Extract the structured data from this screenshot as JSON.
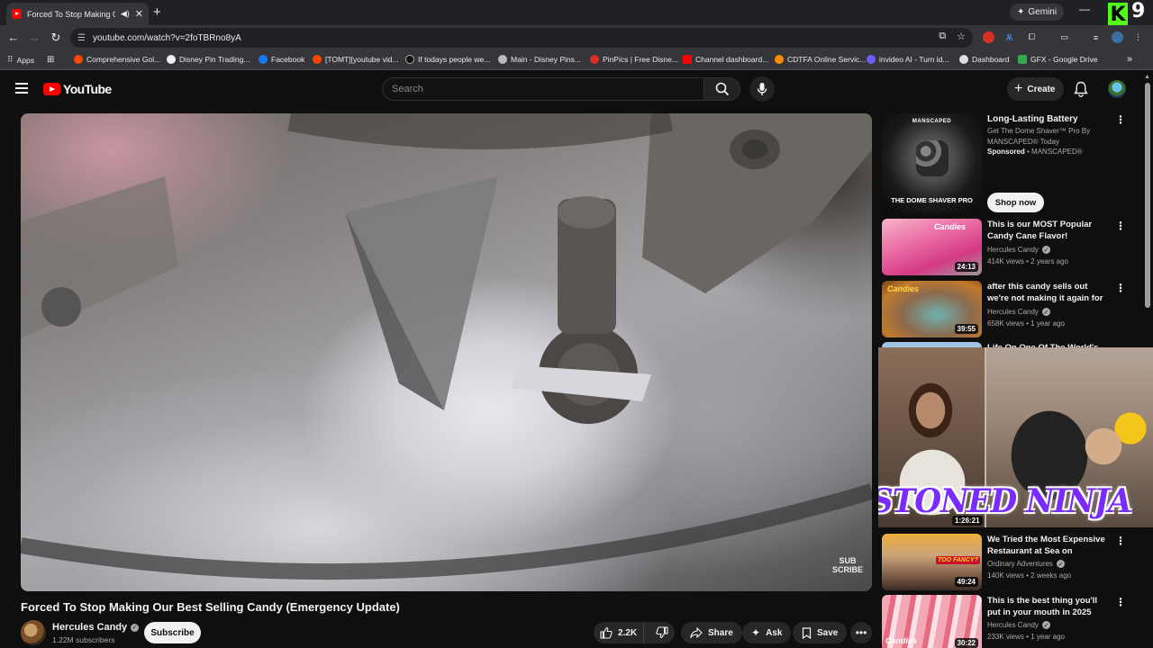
{
  "browser": {
    "tab_title": "Forced To Stop Making Ou",
    "gemini_label": "Gemini",
    "url": "youtube.com/watch?v=2foTBRno8yA",
    "kick_badge": "9",
    "bookmarks": [
      {
        "label": "Apps",
        "color": "#e8eaed"
      },
      {
        "label": "Comprehensive Gol...",
        "color": "#ff4500"
      },
      {
        "label": "Disney Pin Trading...",
        "color": "#f1f1f1"
      },
      {
        "label": "Facebook",
        "color": "#1877f2"
      },
      {
        "label": "[TOMT][youtube vid...",
        "color": "#ff4500"
      },
      {
        "label": "If todays people we...",
        "color": "#111111"
      },
      {
        "label": "Main - Disney Pins...",
        "color": "#bbbbbb"
      },
      {
        "label": "PinPics | Free Disne...",
        "color": "#d93025"
      },
      {
        "label": "Channel dashboard...",
        "color": "#ff0000"
      },
      {
        "label": "CDTFA Online Servic...",
        "color": "#ff8c00"
      },
      {
        "label": "invideo AI - Turn id...",
        "color": "#6a5cff"
      },
      {
        "label": "Dashboard",
        "color": "#dddddd"
      },
      {
        "label": "GFX - Google Drive",
        "color": "#34a853"
      }
    ]
  },
  "header": {
    "logo_text": "YouTube",
    "search_placeholder": "Search",
    "create_label": "Create"
  },
  "video": {
    "watermark_line1": "SUB",
    "watermark_line2": "SCRIBE",
    "title": "Forced To Stop Making Our Best Selling Candy (Emergency Update)",
    "channel": "Hercules Candy",
    "subscribers": "1.22M subscribers",
    "subscribe_label": "Subscribe",
    "likes": "2.2K",
    "share_label": "Share",
    "ask_label": "Ask",
    "save_label": "Save"
  },
  "sidebar": {
    "ad": {
      "thumb_brand": "MANSCAPED",
      "thumb_product": "THE DOME SHAVER PRO",
      "title": "Long-Lasting Battery",
      "description": "Get The Dome Shaver™ Pro By MANSCAPED® Today",
      "sponsored": "Sponsored",
      "advertiser": "• MANSCAPED®",
      "cta": "Shop now"
    },
    "recommendations": [
      {
        "title": "This is our MOST Popular Candy Cane Flavor!",
        "channel": "Hercules Candy",
        "views": "414K views",
        "age": "2 years ago",
        "duration": "24:13",
        "thumb_text": "Candies"
      },
      {
        "title": "after this candy sells out we're not making it again for anothe...",
        "channel": "Hercules Candy",
        "views": "658K views",
        "age": "1 year ago",
        "duration": "39:55",
        "thumb_text": "Candies"
      },
      {
        "title": "Life On One Of The World's",
        "duration": "1:26:21"
      },
      {
        "title": "We Tried the Most Expensive Restaurant at Sea on Disney's ...",
        "channel": "Ordinary Adventures",
        "views": "140K views",
        "age": "2 weeks ago",
        "duration": "49:24",
        "thumb_text": "TOO FANCY?"
      },
      {
        "title": "This is the best thing you'll put in your mouth in 2025",
        "channel": "Hercules Candy",
        "views": "233K views",
        "age": "1 year ago",
        "duration": "30:22",
        "thumb_text": "Candies"
      }
    ]
  },
  "overlay": {
    "caption": "STONED NINJA"
  }
}
